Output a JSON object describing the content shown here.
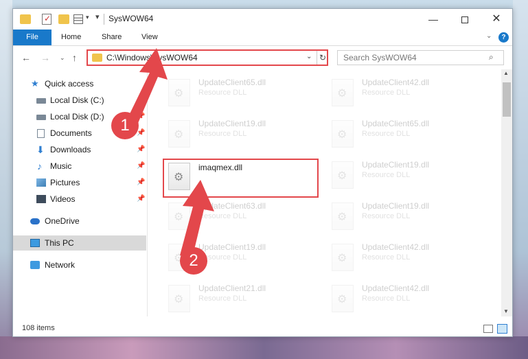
{
  "window": {
    "title": "SysWOW64",
    "minimize": "—",
    "close": "✕"
  },
  "ribbon": {
    "tabs": [
      "File",
      "Home",
      "Share",
      "View"
    ],
    "help": "?"
  },
  "address_bar": {
    "path": "C:\\Windows\\SysWOW64"
  },
  "search": {
    "placeholder": "Search SysWOW64"
  },
  "nav_pane": {
    "items": [
      {
        "label": "Quick access",
        "icon": "star-icon"
      },
      {
        "label": "Local Disk (C:)",
        "icon": "drive-icon",
        "pinned": true
      },
      {
        "label": "Local Disk (D:)",
        "icon": "drive-icon",
        "pinned": true
      },
      {
        "label": "Documents",
        "icon": "document-icon",
        "pinned": true
      },
      {
        "label": "Downloads",
        "icon": "download-icon",
        "pinned": true
      },
      {
        "label": "Music",
        "icon": "music-icon",
        "pinned": true
      },
      {
        "label": "Pictures",
        "icon": "pictures-icon",
        "pinned": true
      },
      {
        "label": "Videos",
        "icon": "video-icon",
        "pinned": true
      },
      {
        "label": "OneDrive",
        "icon": "cloud-icon"
      },
      {
        "label": "This PC",
        "icon": "computer-icon",
        "selected": true
      },
      {
        "label": "Network",
        "icon": "network-icon"
      }
    ]
  },
  "files": {
    "left": [
      {
        "name": "UpdateClient65.dll",
        "type": "Resource DLL"
      },
      {
        "name": "UpdateClient19.dll",
        "type": "Resource DLL"
      },
      {
        "name": "imaqmex.dll",
        "type": ""
      },
      {
        "name": "UpdateClient63.dll",
        "type": "Resource DLL"
      },
      {
        "name": "UpdateClient19.dll",
        "type": "Resource DLL"
      },
      {
        "name": "UpdateClient21.dll",
        "type": "Resource DLL"
      }
    ],
    "right": [
      {
        "name": "UpdateClient42.dll",
        "type": "Resource DLL"
      },
      {
        "name": "UpdateClient65.dll",
        "type": "Resource DLL"
      },
      {
        "name": "UpdateClient19.dll",
        "type": "Resource DLL"
      },
      {
        "name": "UpdateClient19.dll",
        "type": "Resource DLL"
      },
      {
        "name": "UpdateClient42.dll",
        "type": "Resource DLL"
      },
      {
        "name": "UpdateClient42.dll",
        "type": "Resource DLL"
      }
    ]
  },
  "status": {
    "item_count": "108 items"
  },
  "annotations": {
    "step1": "1",
    "step2": "2",
    "color": "#e3474b"
  }
}
